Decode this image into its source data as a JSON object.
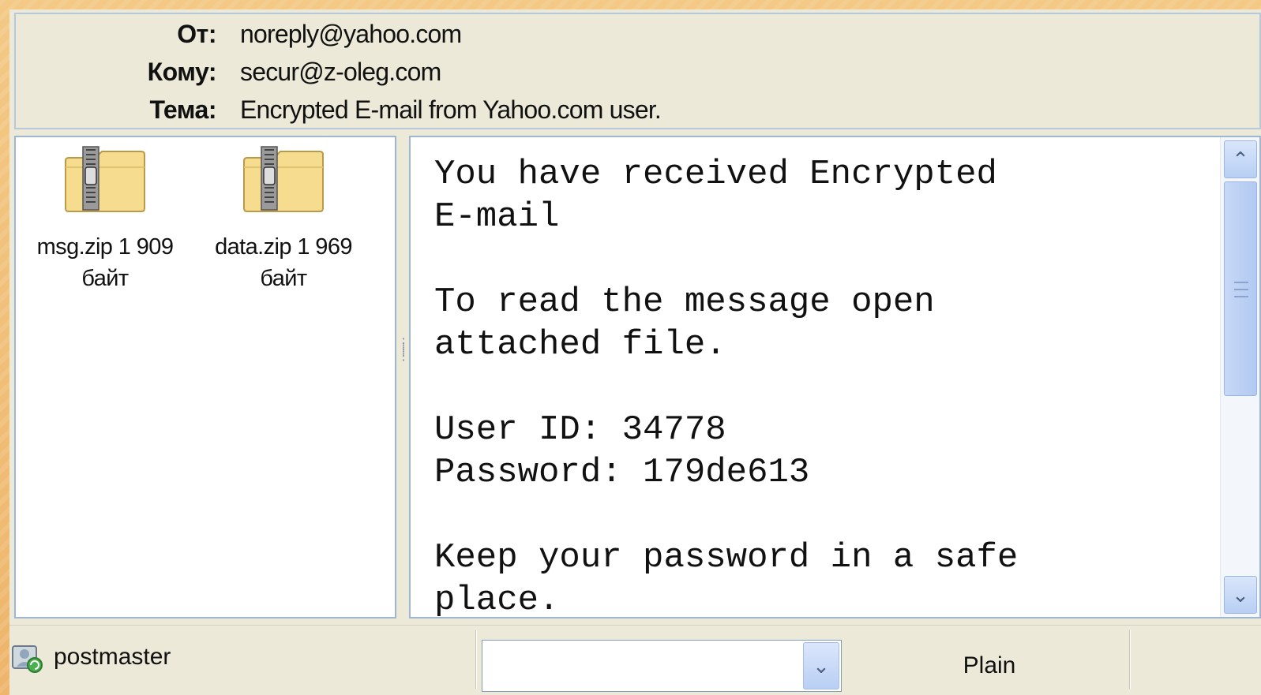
{
  "header": {
    "from_label": "От:",
    "from_value": "noreply@yahoo.com",
    "to_label": "Кому:",
    "to_value": "secur@z-oleg.com",
    "subject_label": "Тема:",
    "subject_value": "Encrypted E-mail from Yahoo.com user."
  },
  "attachments": [
    {
      "name": "msg.zip 1 909",
      "size_unit": "байт",
      "icon": "zip-folder-icon"
    },
    {
      "name": "data.zip 1 969",
      "size_unit": "байт",
      "icon": "zip-folder-icon"
    }
  ],
  "message": {
    "body": "You have received Encrypted\nE-mail\n\nTo read the message open\nattached file.\n\nUser ID: 34778\nPassword: 179de613\n\nKeep your password in a safe\nplace."
  },
  "statusbar": {
    "user": "postmaster",
    "user_icon": "user-refresh-icon",
    "combo_value": "",
    "format": "Plain"
  },
  "colors": {
    "window_bg": "#ece9d8",
    "pane_border": "#9eb6cf",
    "scroll_accent": "#b8cff3",
    "page_bg": "#f2c27a"
  }
}
